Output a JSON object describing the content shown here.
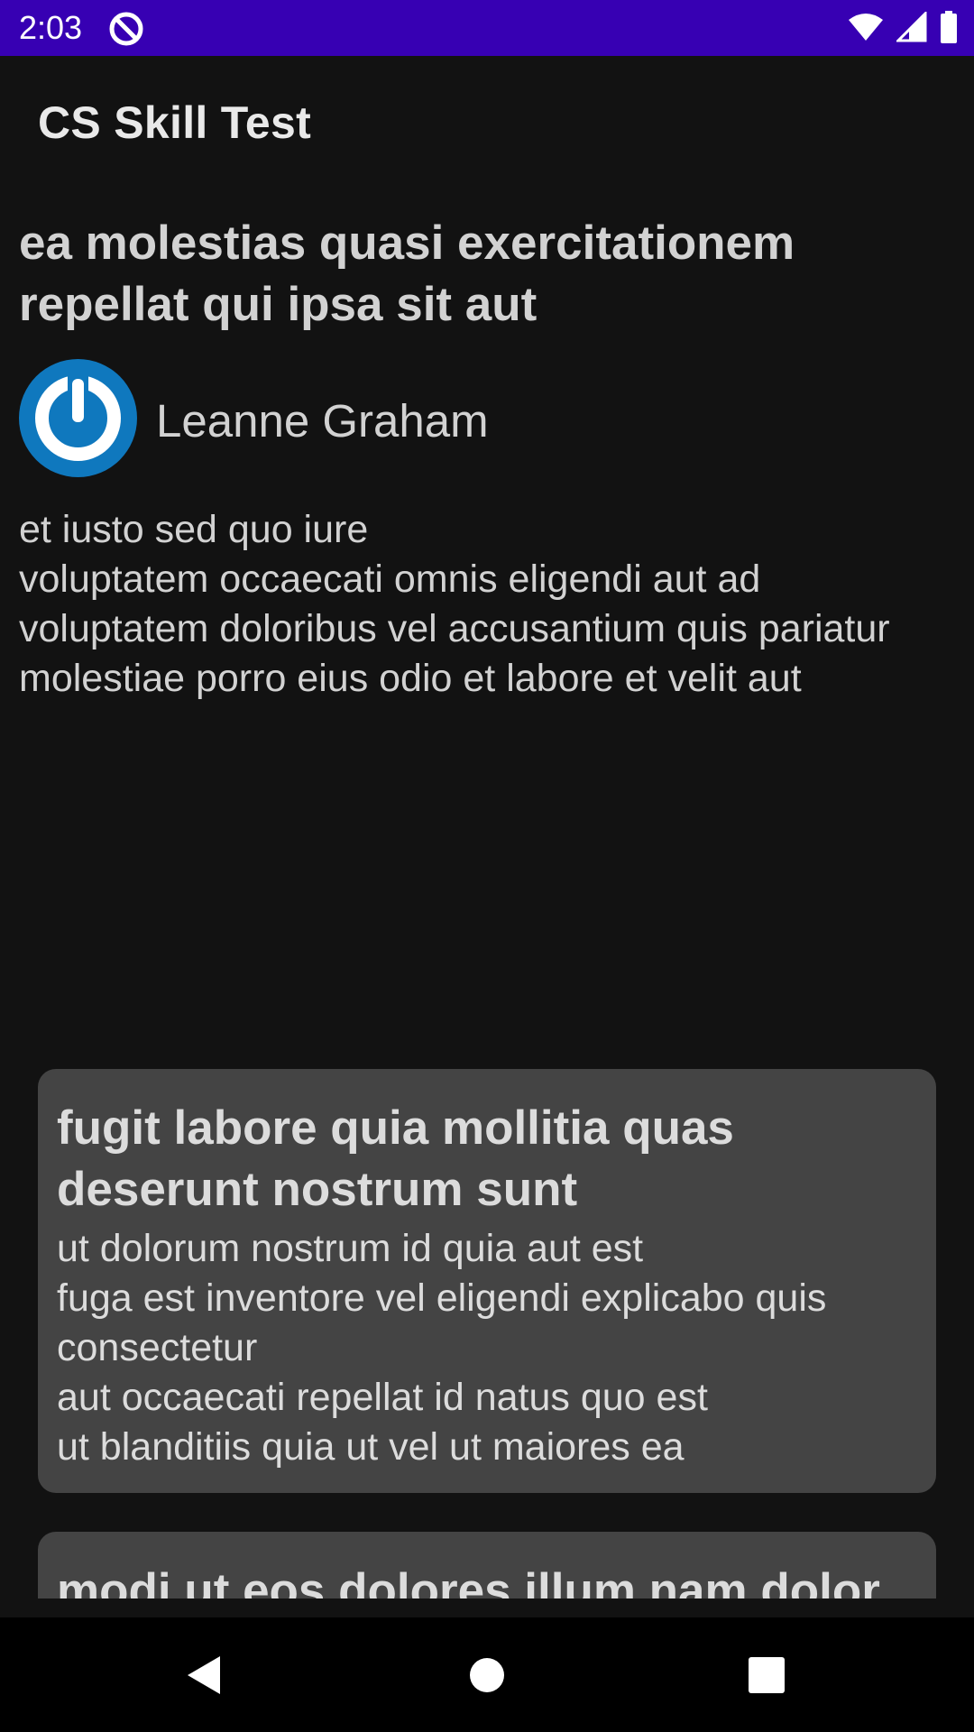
{
  "status_bar": {
    "time": "2:03",
    "background": "#3700b3",
    "icons": [
      "app-notification-icon",
      "wifi-icon",
      "cellular-signal-icon",
      "battery-icon"
    ]
  },
  "app_bar": {
    "title": "CS Skill Test"
  },
  "post": {
    "title": "ea molestias quasi exercitationem repellat qui ipsa sit aut",
    "author": "Leanne Graham",
    "avatar_icon": "power-icon",
    "avatar_color": "#0f78be",
    "body": "et iusto sed quo iure\nvoluptatem occaecati omnis eligendi aut ad\nvoluptatem doloribus vel accusantium quis pariatur\nmolestiae porro eius odio et labore et velit aut"
  },
  "comments": [
    {
      "title": "fugit labore quia mollitia quas deserunt nostrum sunt",
      "body": "ut dolorum nostrum id quia aut est\nfuga est inventore vel eligendi explicabo quis consectetur\naut occaecati repellat id natus quo est\nut blanditiis quia ut vel ut maiores ea"
    },
    {
      "title": "modi ut eos dolores illum nam dolor",
      "body": ""
    }
  ],
  "nav_bar": {
    "icons": [
      "back-icon",
      "home-icon",
      "recents-icon"
    ]
  },
  "colors": {
    "background": "#121212",
    "card": "#444444",
    "text": "#d2d2d2"
  }
}
